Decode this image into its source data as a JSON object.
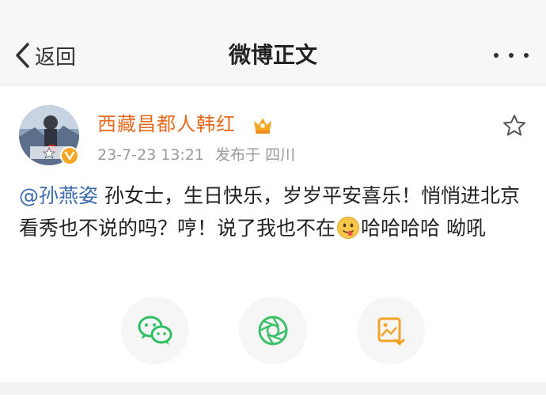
{
  "header": {
    "back_label": "返回",
    "title": "微博正文"
  },
  "post": {
    "author": "西藏昌都人韩红",
    "time": "23-7-23 13:21",
    "source": "发布于 四川",
    "mention": "@孙燕姿",
    "text_part1": " 孙女士，生日快乐，岁岁平安喜乐！悄悄进北京看秀也不说的吗？哼！说了我也不在",
    "text_part2": "哈哈哈哈 呦吼"
  },
  "share": {
    "icons": [
      "wechat-icon",
      "moments-icon",
      "save-image-icon"
    ]
  },
  "colors": {
    "username": "#e86a1e",
    "mention": "#3a6bb0",
    "wechat": "#2fbf62",
    "moments": "#3cc06a",
    "save_image": "#f2a32b"
  }
}
